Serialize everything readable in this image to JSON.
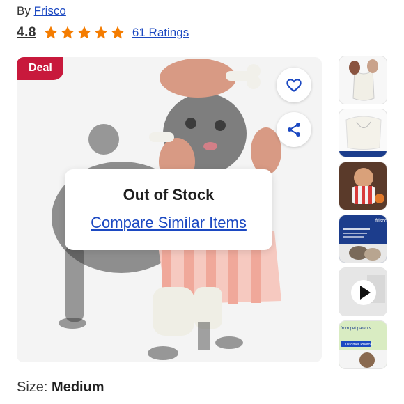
{
  "brand": {
    "prefix": "By",
    "name": "Frisco"
  },
  "rating": {
    "value": "4.8",
    "stars": 5,
    "count_label": "61 Ratings",
    "star_color": "#f47c00"
  },
  "gallery": {
    "badge": "Deal",
    "badge_color": "#c8193c",
    "favorite_icon": "heart-icon",
    "share_icon": "share-icon",
    "status_title": "Out of Stock",
    "compare_link": "Compare Similar Items"
  },
  "thumbnails": [
    {
      "alt": "costume flat lay",
      "icon": "costume-icon"
    },
    {
      "alt": "costume measurement guide",
      "icon": "measure-icon"
    },
    {
      "alt": "poodle wearing costume",
      "icon": "dog-photo-icon"
    },
    {
      "alt": "frisco brand promo",
      "icon": "promo-icon",
      "text": "frisco"
    },
    {
      "alt": "product video",
      "icon": "play-icon"
    },
    {
      "alt": "pet parent review",
      "icon": "review-icon",
      "text": "from pet parents",
      "sub": "Customer Photos"
    }
  ],
  "size": {
    "label": "Size:",
    "value": "Medium"
  },
  "colors": {
    "link": "#1c49c2"
  }
}
